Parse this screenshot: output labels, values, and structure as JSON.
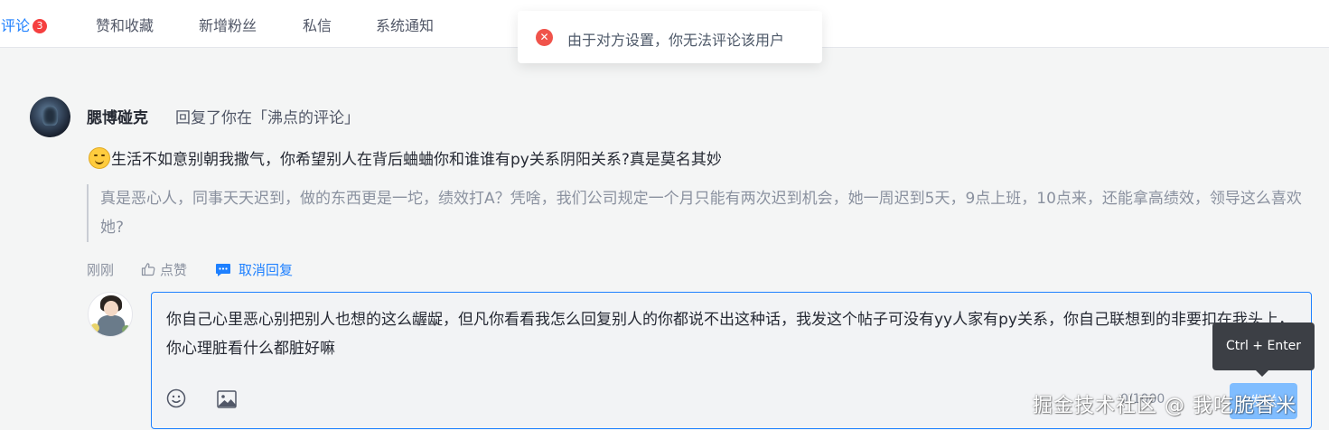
{
  "nav": {
    "tabs": [
      {
        "label": "评论",
        "badge": "3",
        "active": true
      },
      {
        "label": "赞和收藏"
      },
      {
        "label": "新增粉丝"
      },
      {
        "label": "私信"
      },
      {
        "label": "系统通知"
      }
    ]
  },
  "toast": {
    "message": "由于对方设置，你无法评论该用户",
    "icon": "error-circle-icon"
  },
  "notification": {
    "username": "腮博碰克",
    "action_text": "回复了你在「沸点的评论」",
    "comment_text": "生活不如意别朝我撒气，你希望别人在背后蛐蛐你和谁谁有py关系阴阳关系?真是莫名其妙",
    "quoted_text": "真是恶心人，同事天天迟到，做的东西更是一坨，绩效打A？凭啥，我们公司规定一个月只能有两次迟到机会，她一周迟到5天，9点上班，10点来，还能拿高绩效，领导这么喜欢她?",
    "time": "刚刚",
    "like_label": "点赞",
    "cancel_reply_label": "取消回复"
  },
  "reply_editor": {
    "text": "你自己心里恶心别把别人也想的这么龌龊，但凡你看看我怎么回复别人的你都说不出这种话，我发这个帖子可没有yy人家有py关系，你自己联想到的非要扣在我头上，你心理脏看什么都脏好嘛",
    "shortcut_tooltip": "Ctrl + Enter",
    "char_count": "0/1000",
    "submit_label": "发送"
  },
  "watermark": "掘金技术社区 @ 我吃脆香米",
  "colors": {
    "accent": "#1e80ff",
    "badge": "#f53f3f",
    "error": "#f0534b",
    "background": "#f4f5f5"
  }
}
